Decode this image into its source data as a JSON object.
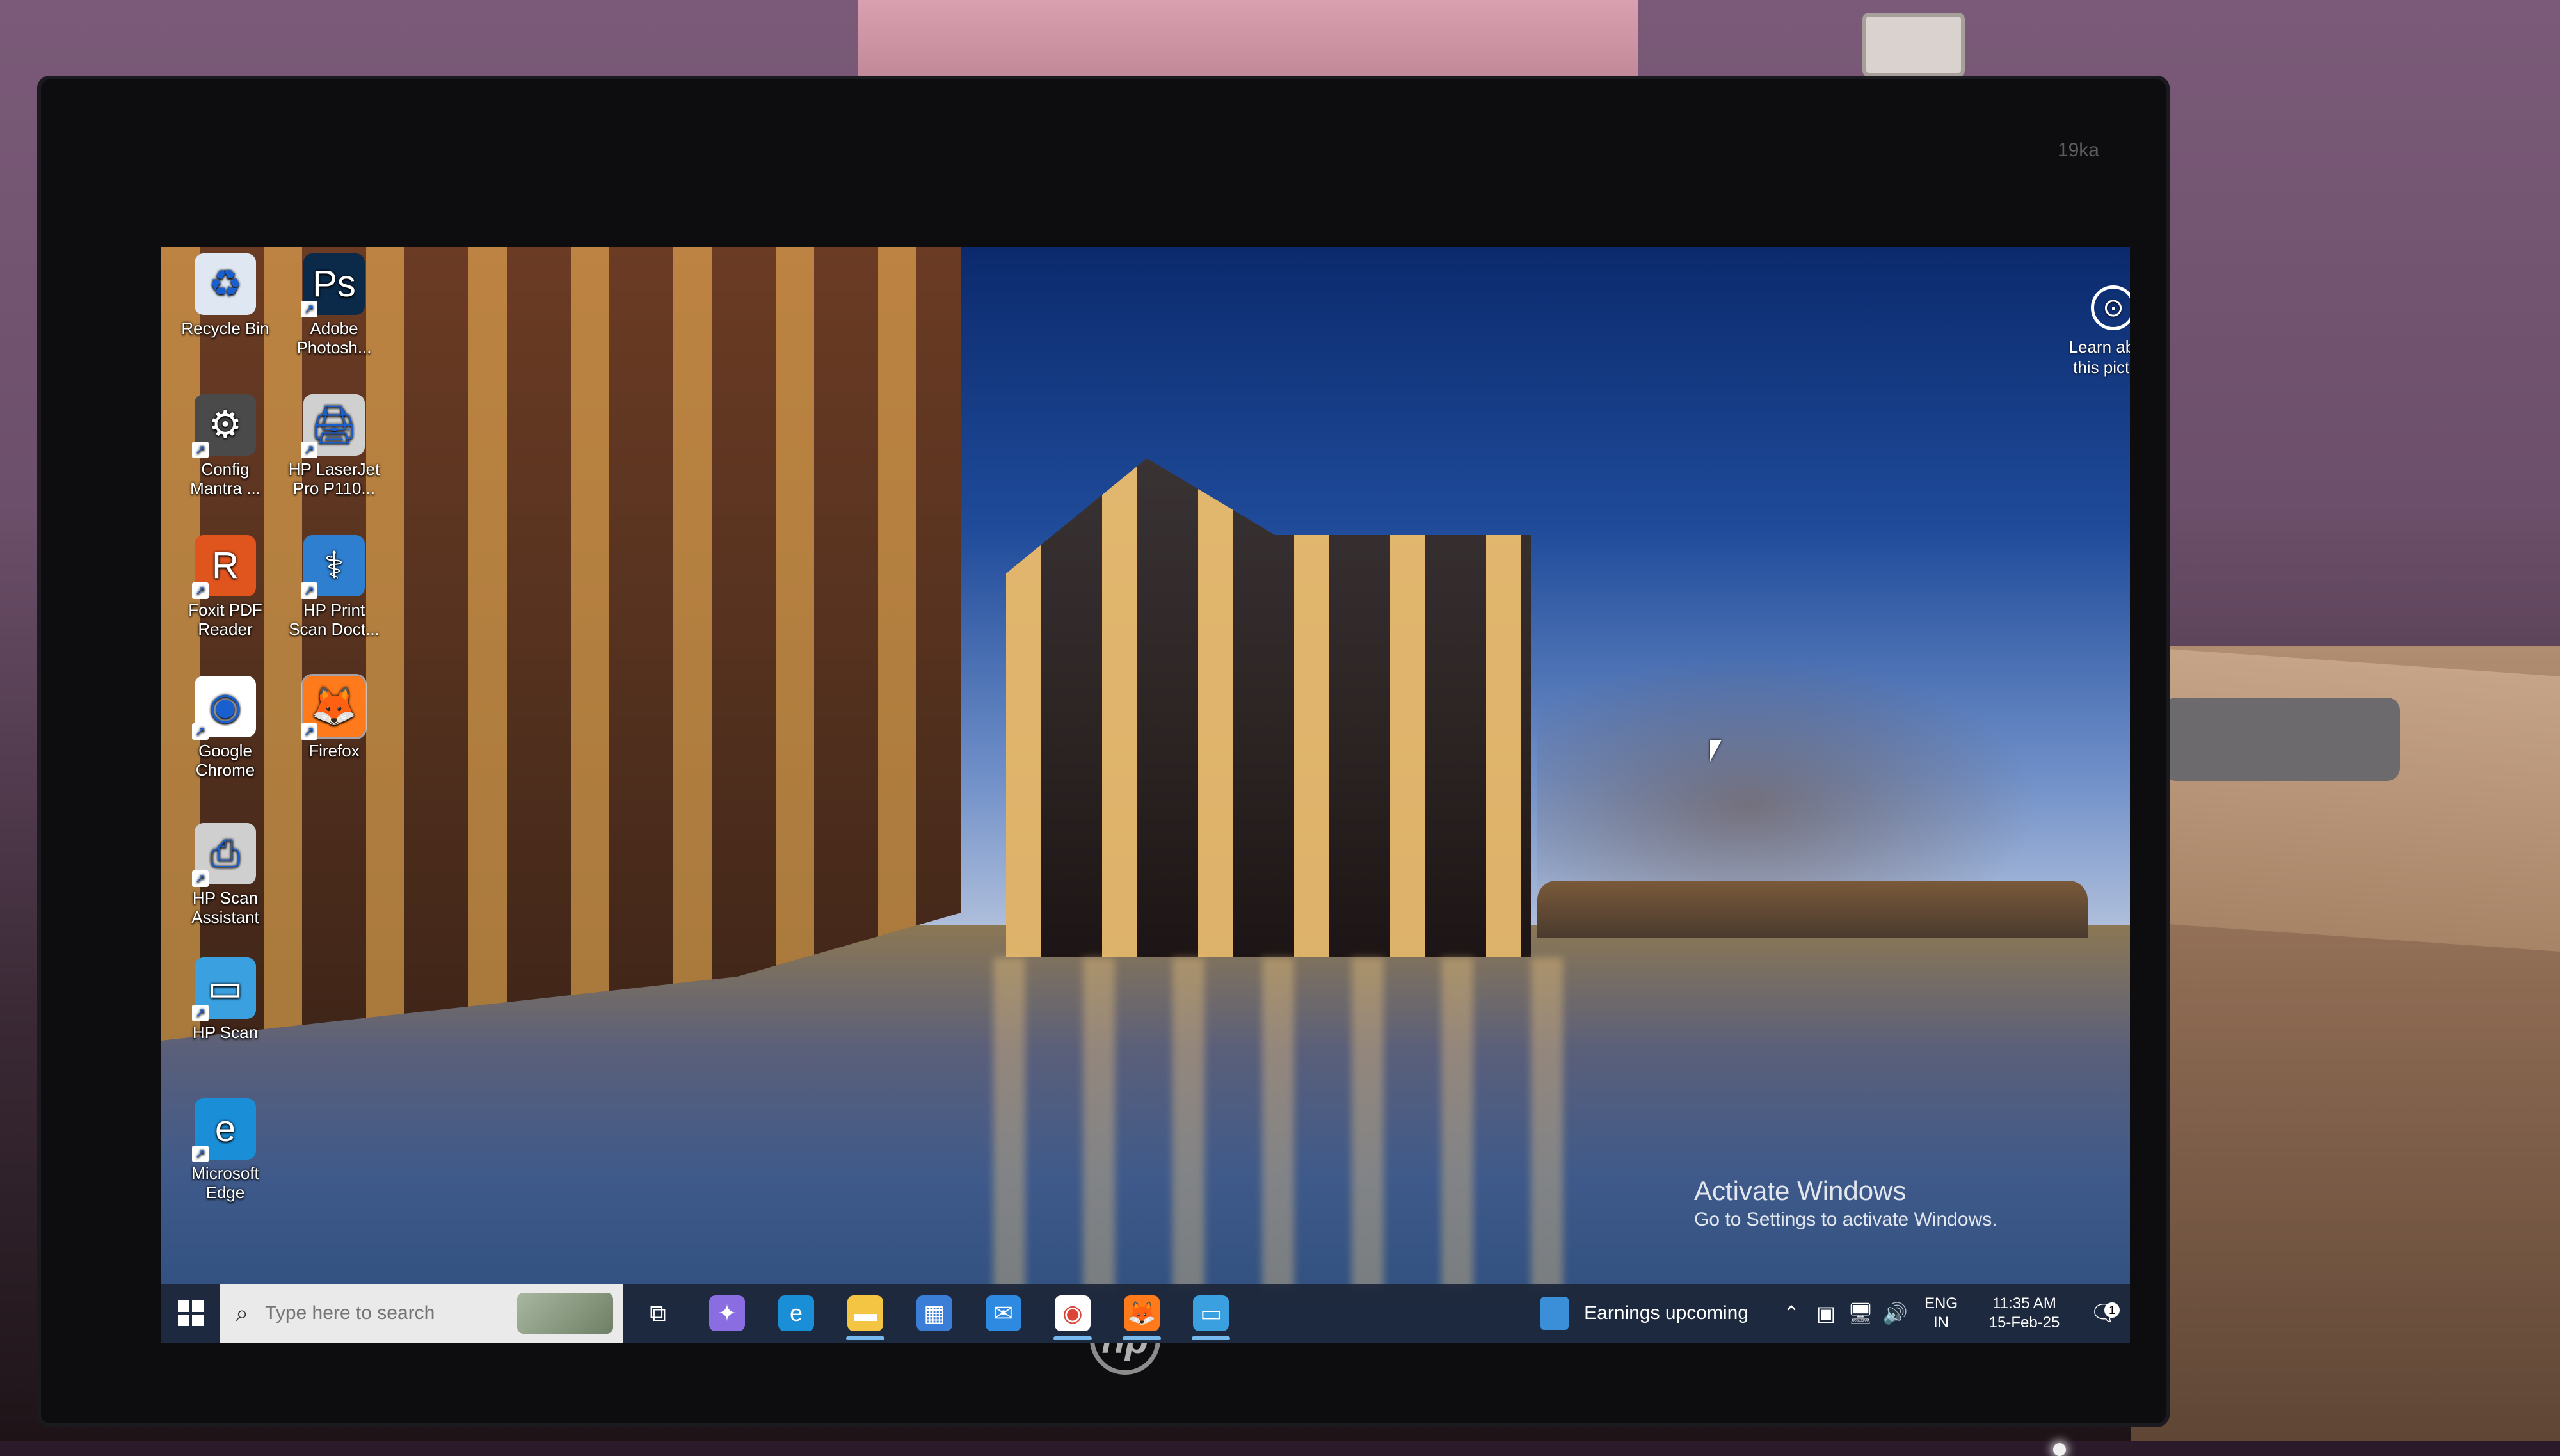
{
  "monitor": {
    "model_label": "19ka",
    "brand_logo": "hp"
  },
  "desktop": {
    "icons": [
      {
        "label": "Recycle Bin",
        "icon": "recycle-bin-icon",
        "color": "#dfe8f2",
        "glyph": "♻"
      },
      {
        "label": "Adobe Photosh...",
        "icon": "photoshop-icon",
        "color": "#0b2a4a",
        "glyph": "Ps"
      },
      {
        "label": "Config Mantra ...",
        "icon": "config-mantra-icon",
        "color": "#4a4a4a",
        "glyph": "⚙"
      },
      {
        "label": "HP LaserJet Pro P110...",
        "icon": "printer-icon",
        "color": "#d0d0d0",
        "glyph": "🖨"
      },
      {
        "label": "Foxit PDF Reader",
        "icon": "foxit-reader-icon",
        "color": "#e0541e",
        "glyph": "R"
      },
      {
        "label": "HP Print Scan Doct...",
        "icon": "hp-print-scan-doctor-icon",
        "color": "#2f7fd1",
        "glyph": "⚕"
      },
      {
        "label": "Google Chrome",
        "icon": "chrome-icon",
        "color": "#ffffff",
        "glyph": "◉"
      },
      {
        "label": "Firefox",
        "icon": "firefox-icon",
        "color": "#ff7a1a",
        "glyph": "🦊"
      },
      {
        "label": "HP Scan Assistant",
        "icon": "scanner-icon",
        "color": "#cfcfcf",
        "glyph": "⎙"
      },
      {
        "label": "HP Scan",
        "icon": "hp-scan-icon",
        "color": "#3aa0e0",
        "glyph": "▭"
      },
      {
        "label": "Microsoft Edge",
        "icon": "edge-icon",
        "color": "#1a8fd8",
        "glyph": "e"
      }
    ],
    "learn_picture": "Learn about this picture",
    "activate_title": "Activate Windows",
    "activate_subtitle": "Go to Settings to activate Windows."
  },
  "taskbar": {
    "search_placeholder": "Type here to search",
    "apps": [
      {
        "name": "task-view",
        "icon": "task-view-icon",
        "glyph": "⧉",
        "color": "transparent",
        "active": false
      },
      {
        "name": "copilot",
        "icon": "copilot-icon",
        "glyph": "✦",
        "color": "#8a6de0",
        "active": false
      },
      {
        "name": "edge",
        "icon": "edge-icon",
        "glyph": "e",
        "color": "#1a8fd8",
        "active": false
      },
      {
        "name": "file-explorer",
        "icon": "folder-icon",
        "glyph": "▬",
        "color": "#f4c542",
        "active": true
      },
      {
        "name": "microsoft-store",
        "icon": "store-icon",
        "glyph": "▦",
        "color": "#3b7ed8",
        "active": false
      },
      {
        "name": "mail",
        "icon": "mail-icon",
        "glyph": "✉",
        "color": "#2e8ae0",
        "active": false
      },
      {
        "name": "chrome",
        "icon": "chrome-icon",
        "glyph": "◉",
        "color": "#ffffff",
        "active": true
      },
      {
        "name": "firefox",
        "icon": "firefox-icon",
        "glyph": "🦊",
        "color": "#ff7a1a",
        "active": true
      },
      {
        "name": "hp-scan",
        "icon": "hp-scan-icon",
        "glyph": "▭",
        "color": "#3aa0e0",
        "active": true
      }
    ],
    "news_label": "Earnings upcoming",
    "language_line1": "ENG",
    "language_line2": "IN",
    "time": "11:35 AM",
    "date": "15-Feb-25",
    "notification_count": "1"
  }
}
